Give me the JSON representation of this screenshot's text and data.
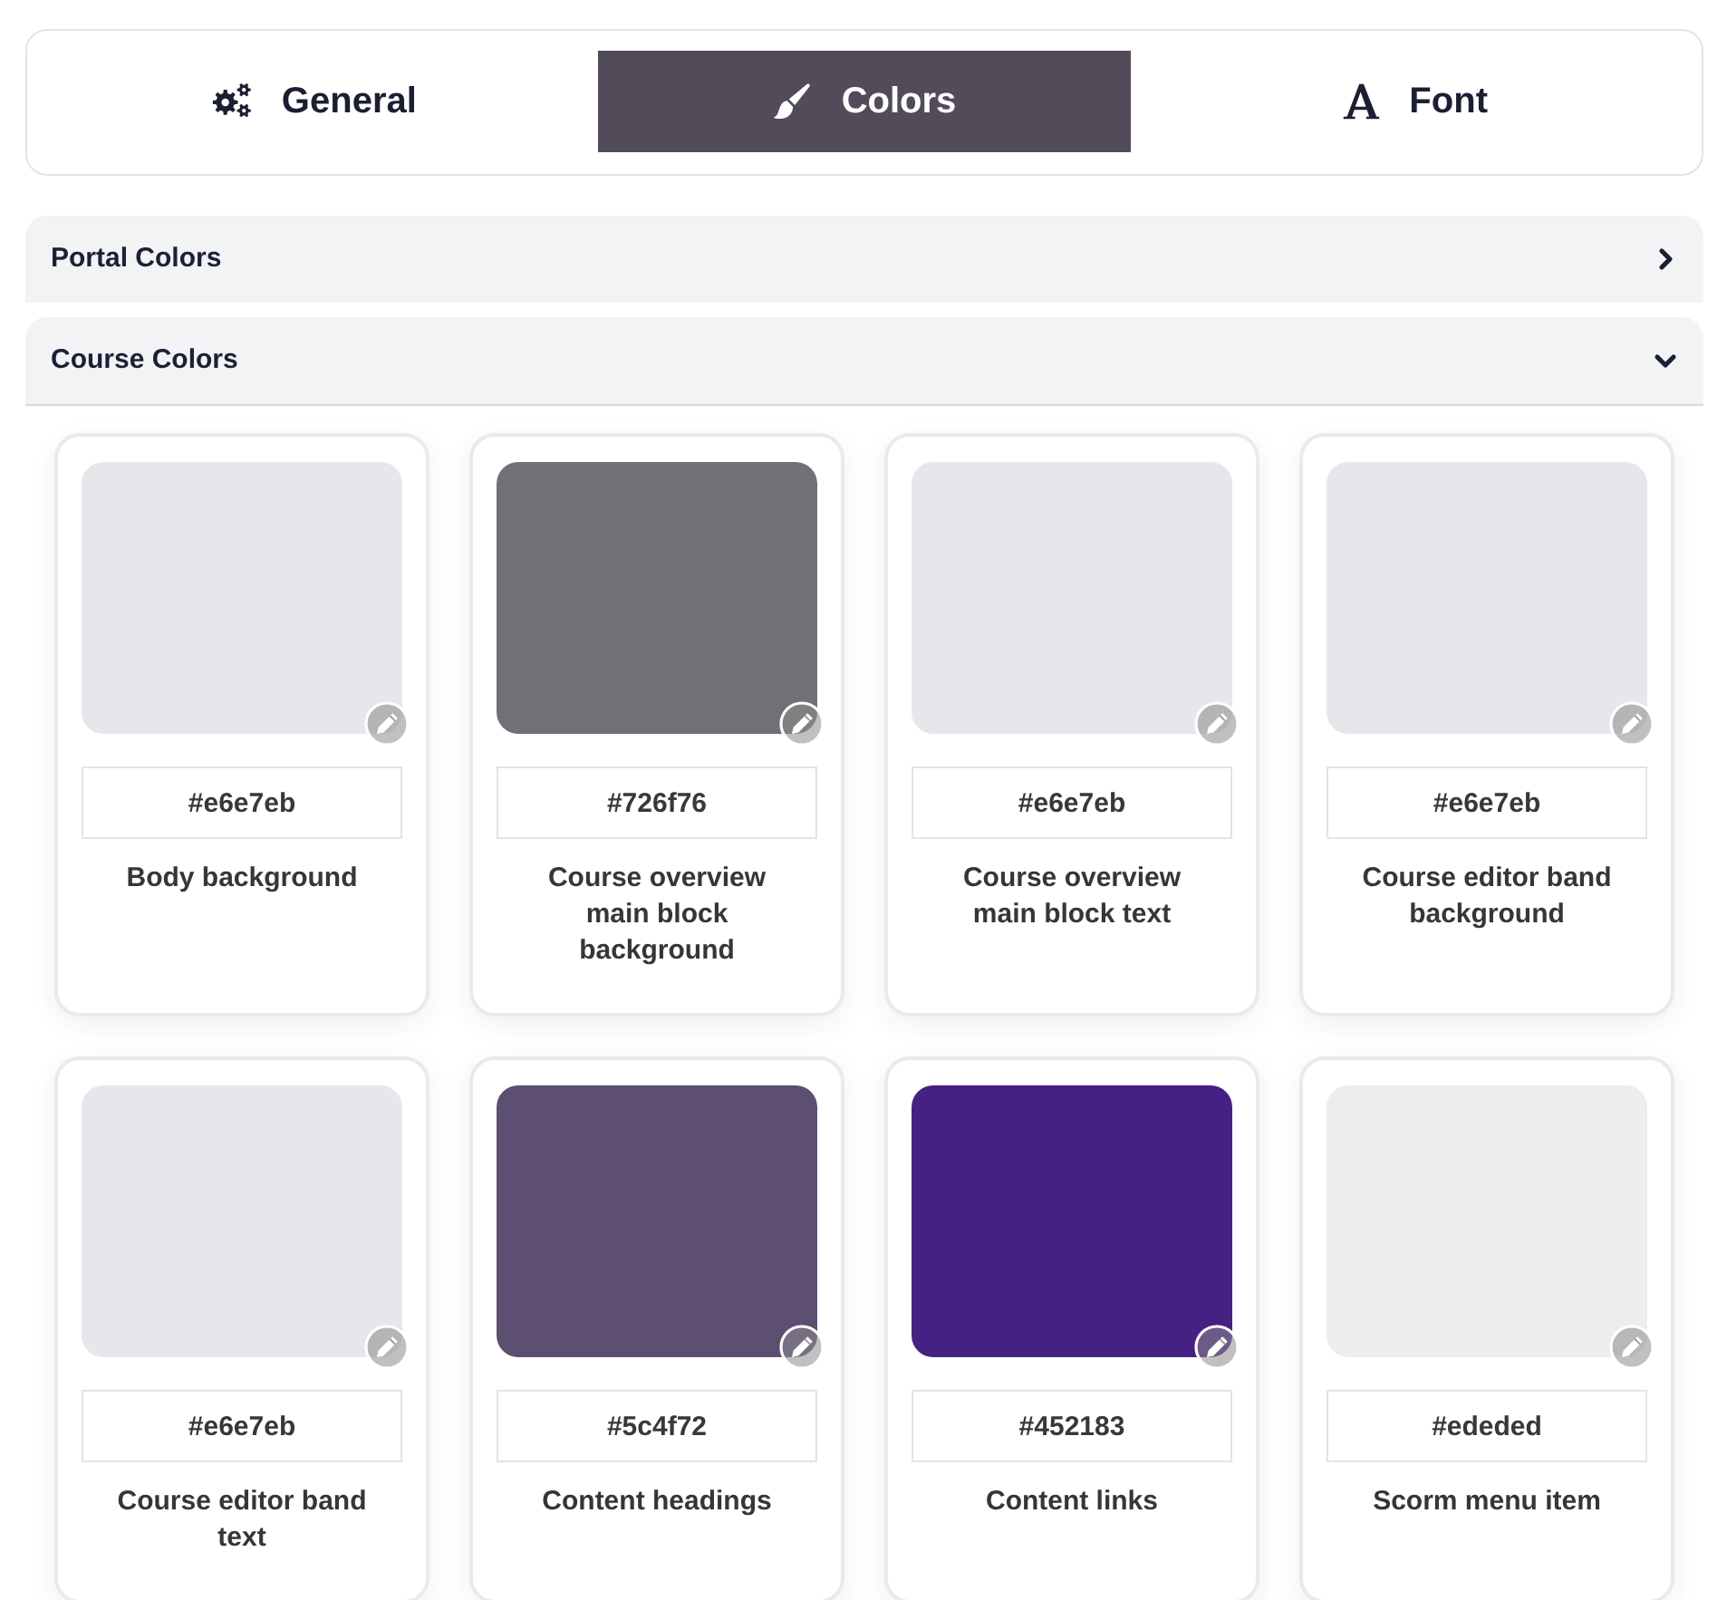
{
  "tabs": [
    {
      "label": "General",
      "selected": false
    },
    {
      "label": "Colors",
      "selected": true
    },
    {
      "label": "Font",
      "selected": false
    }
  ],
  "sections": [
    {
      "title": "Portal Colors",
      "expanded": false
    },
    {
      "title": "Course Colors",
      "expanded": true,
      "colors": [
        {
          "value": "#e6e7eb",
          "color": "#e6e7eb",
          "label": "Body background"
        },
        {
          "value": "#726f76",
          "color": "#726f76",
          "label": "Course overview main block background"
        },
        {
          "value": "#e6e7eb",
          "color": "#e6e7eb",
          "label": "Course overview main block text"
        },
        {
          "value": "#e6e7eb",
          "color": "#e6e7eb",
          "label": "Course editor band background"
        },
        {
          "value": "#e6e7eb",
          "color": "#e6e7eb",
          "label": "Course editor band text"
        },
        {
          "value": "#5c4f72",
          "color": "#5c4f72",
          "label": "Content headings"
        },
        {
          "value": "#452183",
          "color": "#452183",
          "label": "Content links"
        },
        {
          "value": "#ededed",
          "color": "#ededed",
          "label": "Scorm menu item"
        }
      ]
    }
  ]
}
